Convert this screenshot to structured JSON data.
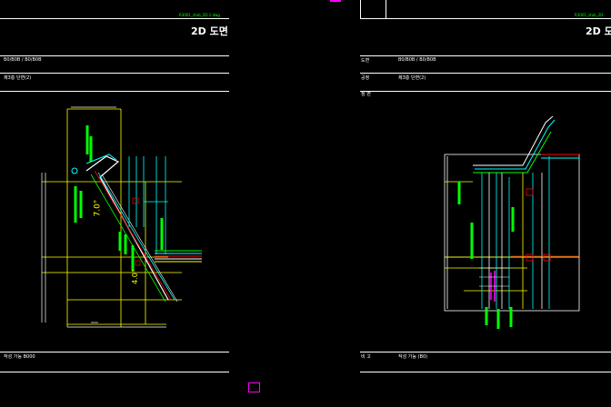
{
  "sheets": {
    "left": {
      "file_code": "R3001_stub_2D-1.dwg",
      "title": "2D 도면",
      "row1": "B0/B0B / B0/B0B",
      "row2": "제3층 단면(2)",
      "footer": "작성 가능 B000",
      "dim_upper": "7.0°",
      "dim_lower": "4.0°"
    },
    "right": {
      "file_code": "R3001_stub_2D-",
      "title": "2D 도",
      "row1_label": "도면",
      "row1": "B0/B0B / B0/B0B",
      "row2_label": "공정",
      "row2": "제3층 단면(2)",
      "row3_label": "정 변",
      "footer_label": "비 고",
      "footer": "작성 가능 (B0)"
    }
  },
  "colors": {
    "background": "#000000",
    "line": "#ffffff",
    "yellow": "#ffff00",
    "green": "#00ff00",
    "cyan": "#00ffff",
    "red": "#ff0000",
    "magenta": "#ff00ff"
  }
}
